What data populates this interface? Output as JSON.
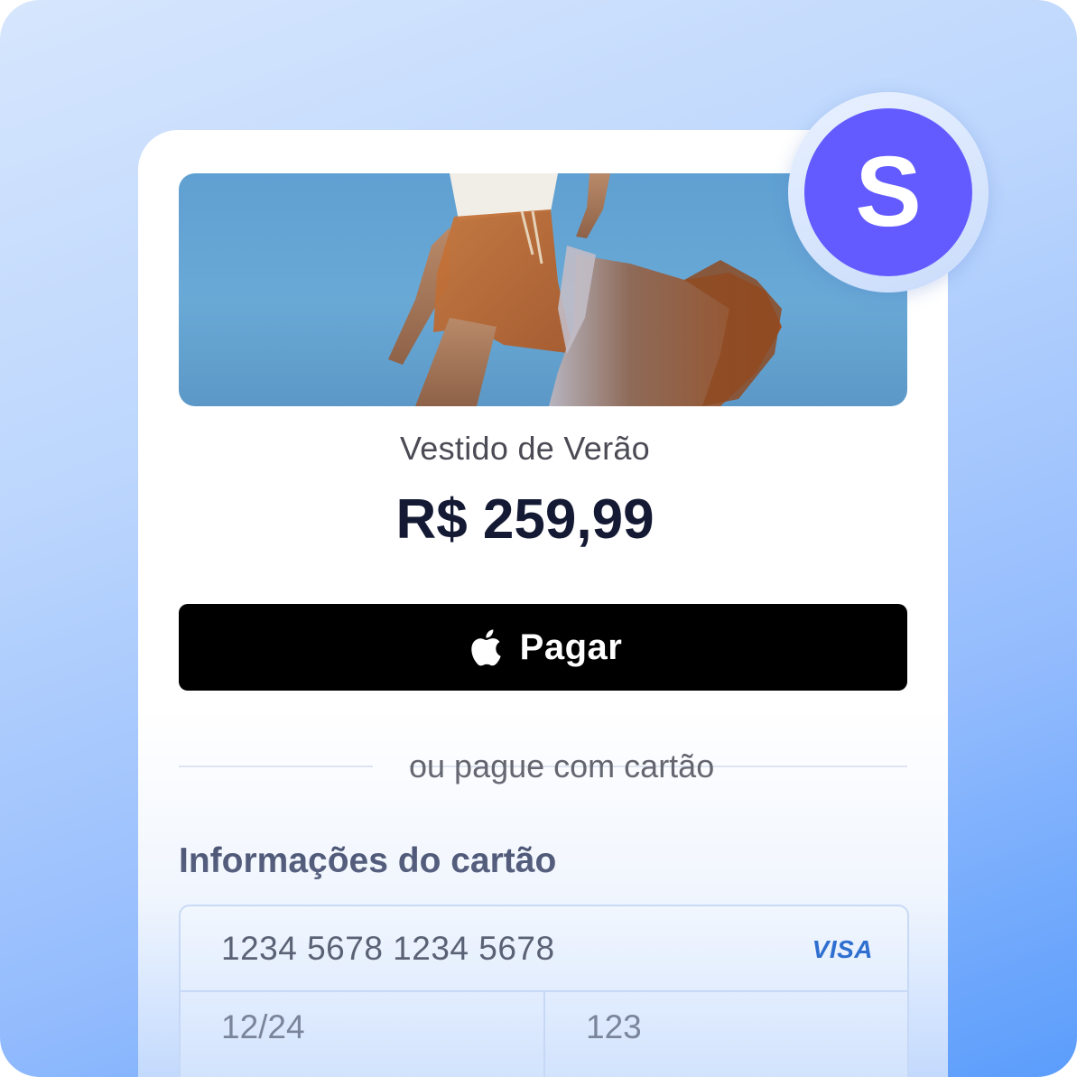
{
  "brand": {
    "badge_letter": "S",
    "badge_color": "#635bff"
  },
  "product": {
    "name": "Vestido de Verão",
    "price": "R$ 259,99"
  },
  "pay_button": {
    "label": "Pagar",
    "icon": "apple-icon"
  },
  "divider": {
    "text": "ou pague com cartão"
  },
  "card_section": {
    "title": "Informações do cartão",
    "card_number": "1234 5678 1234 5678",
    "card_brand": "VISA",
    "expiry": "12/24",
    "cvc": "123"
  },
  "colors": {
    "background_gradient": [
      "#d6e6fd",
      "#5b9dfc"
    ],
    "price_text": "#141a33",
    "button": "#000000"
  }
}
